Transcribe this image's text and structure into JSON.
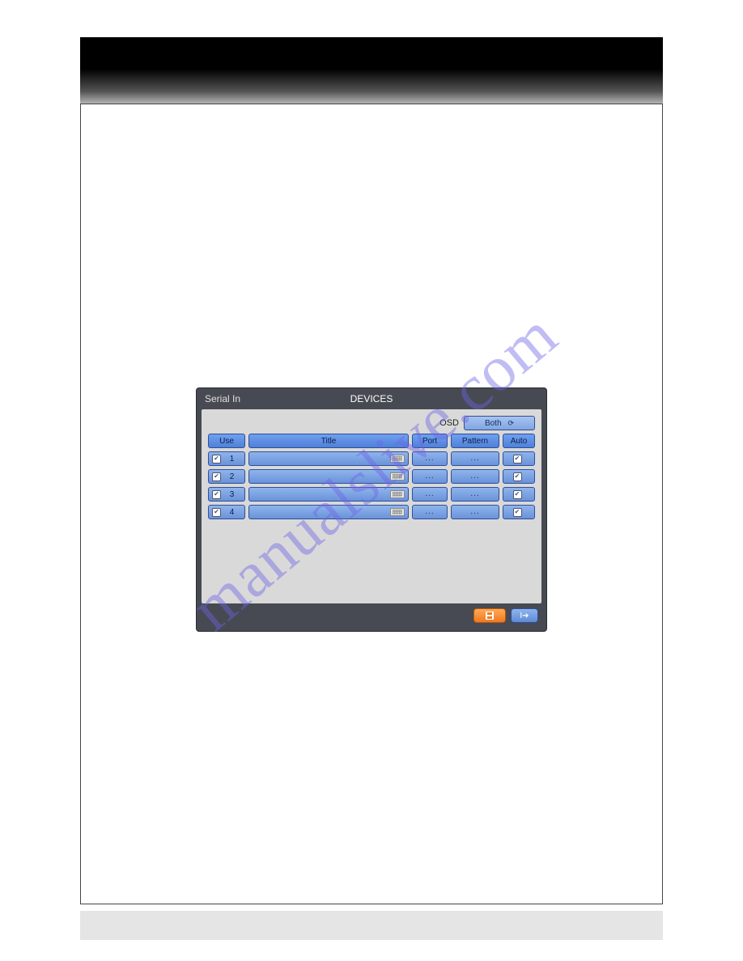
{
  "dialog": {
    "breadcrumb": "Serial In",
    "title": "DEVICES",
    "osd_label": "OSD",
    "osd_value": "Both",
    "headers": {
      "use": "Use",
      "title": "Title",
      "port": "Port",
      "pattern": "Pattern",
      "auto": "Auto"
    },
    "rows": [
      {
        "use": true,
        "num": "1",
        "title": "",
        "port": "...",
        "pattern": "...",
        "auto": true
      },
      {
        "use": true,
        "num": "2",
        "title": "",
        "port": "...",
        "pattern": "...",
        "auto": true
      },
      {
        "use": true,
        "num": "3",
        "title": "",
        "port": "...",
        "pattern": "...",
        "auto": true
      },
      {
        "use": true,
        "num": "4",
        "title": "",
        "port": "...",
        "pattern": "...",
        "auto": true
      }
    ]
  },
  "watermark": "manualslive.com"
}
